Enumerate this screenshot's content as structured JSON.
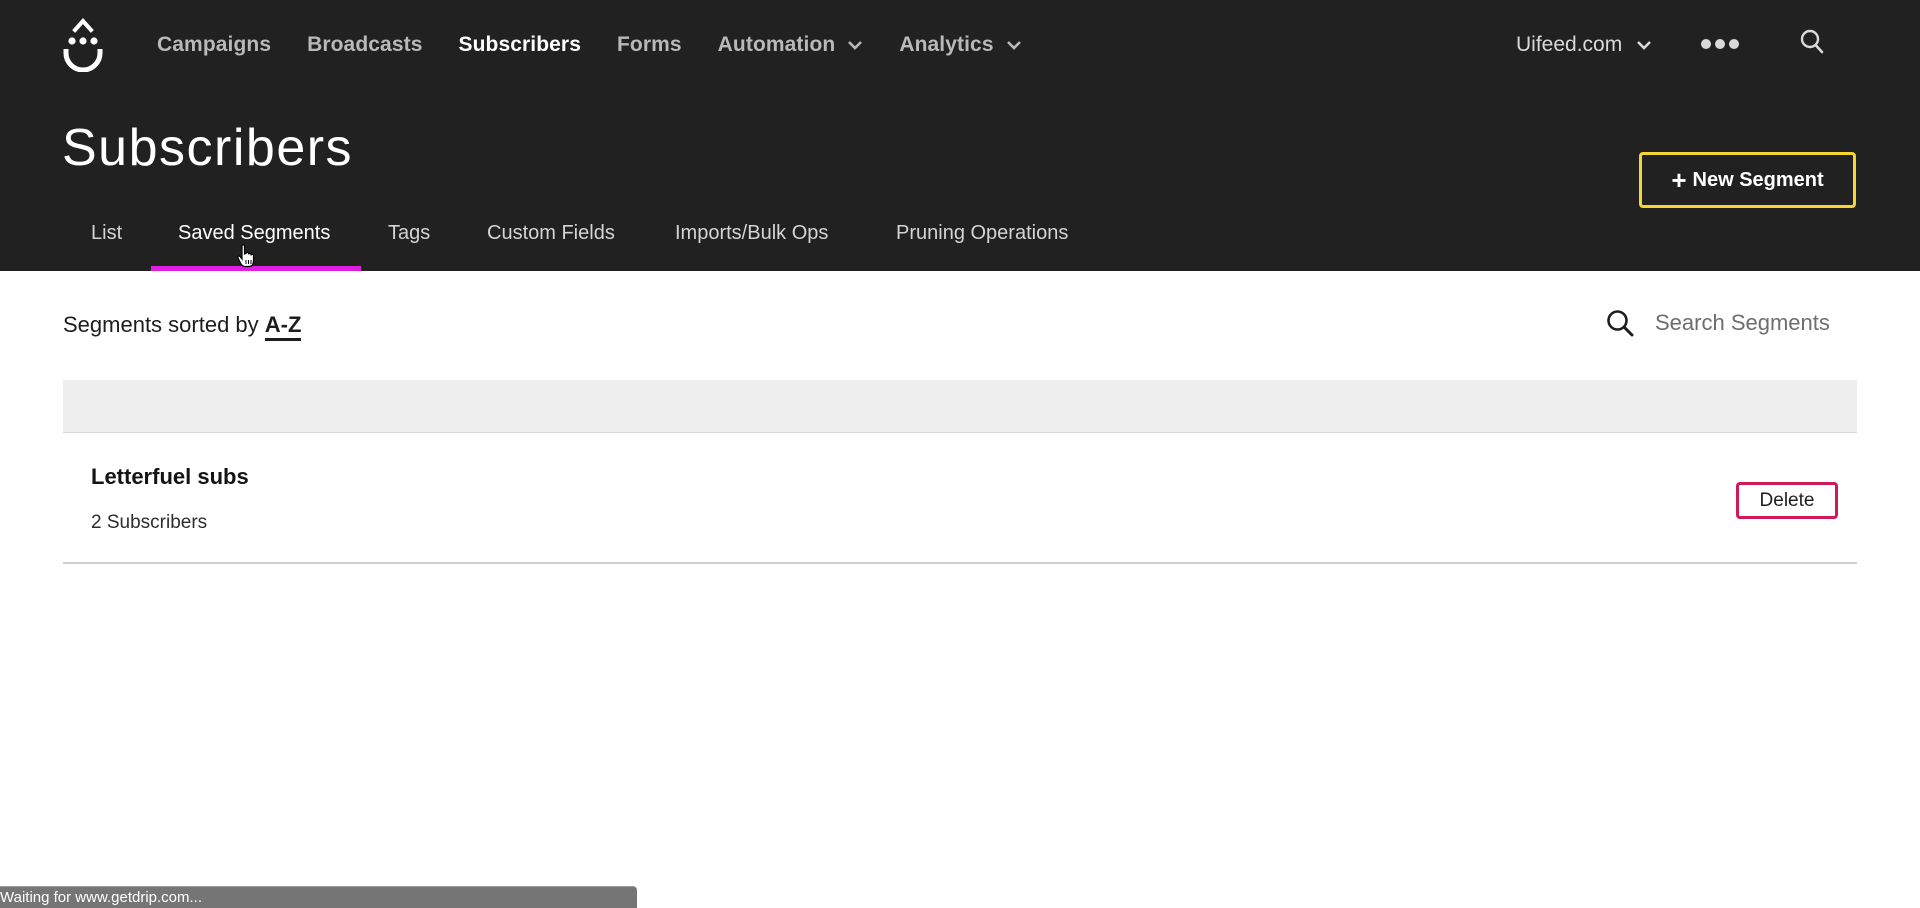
{
  "nav": {
    "logo_name": "drip-logo",
    "items": [
      {
        "label": "Campaigns",
        "active": false,
        "dropdown": false
      },
      {
        "label": "Broadcasts",
        "active": false,
        "dropdown": false
      },
      {
        "label": "Subscribers",
        "active": true,
        "dropdown": false
      },
      {
        "label": "Forms",
        "active": false,
        "dropdown": false
      },
      {
        "label": "Automation",
        "active": false,
        "dropdown": true
      },
      {
        "label": "Analytics",
        "active": false,
        "dropdown": true
      }
    ],
    "account": "Uifeed.com",
    "more_icon": "ellipsis-icon",
    "search_icon": "search-icon"
  },
  "page": {
    "title": "Subscribers",
    "new_button": "New Segment",
    "tabs": [
      {
        "label": "List",
        "active": false
      },
      {
        "label": "Saved Segments",
        "active": true
      },
      {
        "label": "Tags",
        "active": false
      },
      {
        "label": "Custom Fields",
        "active": false
      },
      {
        "label": "Imports/Bulk Ops",
        "active": false
      },
      {
        "label": "Pruning Operations",
        "active": false
      }
    ]
  },
  "segments": {
    "sort_prefix": "Segments sorted by",
    "sort_value": "A-Z",
    "search_placeholder": "Search Segments",
    "rows": [
      {
        "name": "Letterfuel subs",
        "count": "2 Subscribers",
        "action": "Delete"
      }
    ]
  },
  "colors": {
    "header_bg": "#212121",
    "tab_accent": "#e01ee0",
    "new_button_border": "#f5d532",
    "delete_border": "#cf1a55"
  },
  "status_bar": {
    "text": "Waiting for www.getdrip.com..."
  }
}
